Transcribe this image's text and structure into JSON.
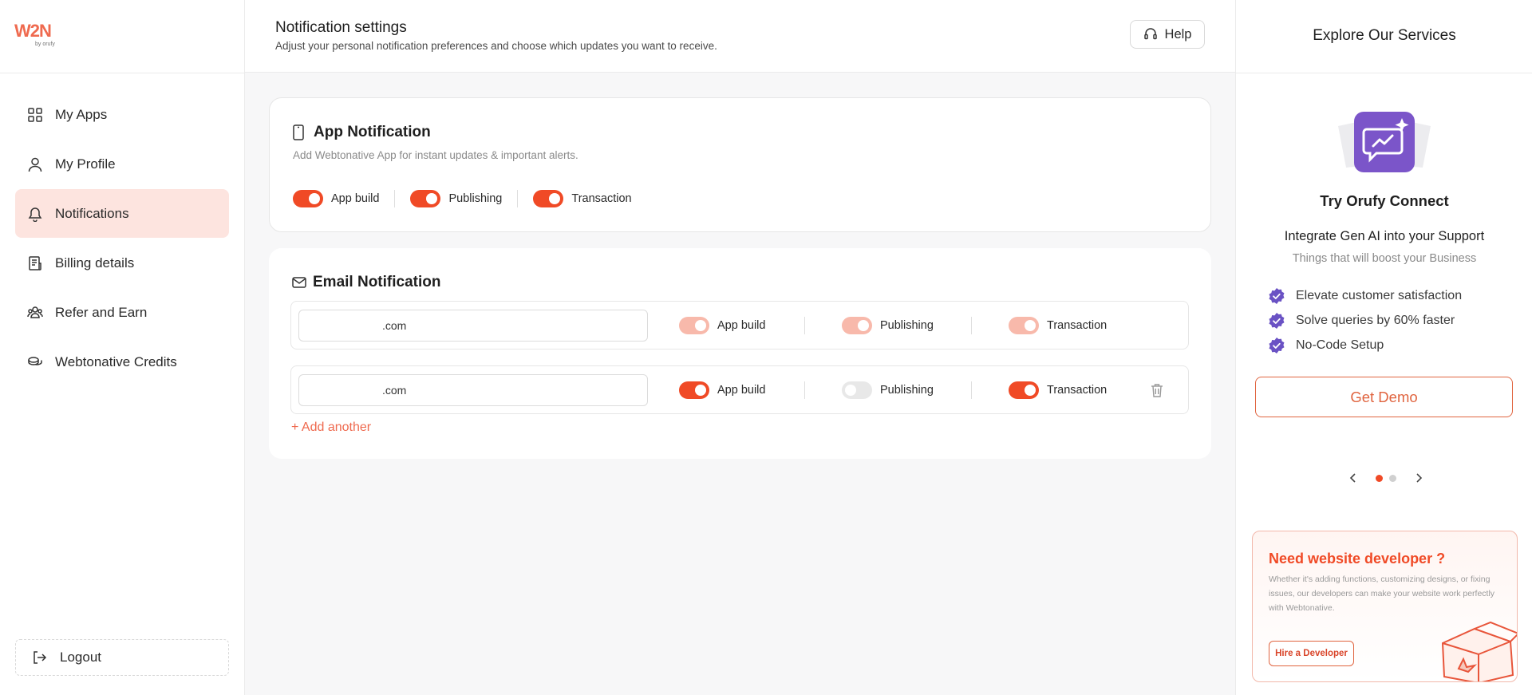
{
  "sidebar": {
    "logo": {
      "wordmark": "W2N",
      "tagline": "by orufy"
    },
    "items": [
      {
        "id": "my-apps",
        "label": "My Apps",
        "icon": "grid-icon",
        "active": false
      },
      {
        "id": "my-profile",
        "label": "My Profile",
        "icon": "user-icon",
        "active": false
      },
      {
        "id": "notifications",
        "label": "Notifications",
        "icon": "bell-icon",
        "active": true
      },
      {
        "id": "billing-details",
        "label": "Billing details",
        "icon": "receipt-icon",
        "active": false
      },
      {
        "id": "refer-and-earn",
        "label": "Refer and Earn",
        "icon": "users-icon",
        "active": false
      },
      {
        "id": "webtonative-credits",
        "label": "Webtonative Credits",
        "icon": "coins-icon",
        "active": false
      }
    ],
    "logout_label": "Logout"
  },
  "header": {
    "title": "Notification settings",
    "subtitle": "Adjust your personal notification preferences and choose which updates you want to receive.",
    "help_label": "Help"
  },
  "app_notification": {
    "title": "App Notification",
    "description": "Add Webtonative App for instant updates & important alerts.",
    "toggles": [
      {
        "label": "App build",
        "state": "on"
      },
      {
        "label": "Publishing",
        "state": "on"
      },
      {
        "label": "Transaction",
        "state": "on"
      }
    ]
  },
  "email_notification": {
    "title": "Email Notification",
    "rows": [
      {
        "email": ".com",
        "deletable": false,
        "toggles": [
          {
            "label": "App build",
            "state": "soft"
          },
          {
            "label": "Publishing",
            "state": "soft"
          },
          {
            "label": "Transaction",
            "state": "soft"
          }
        ]
      },
      {
        "email": ".com",
        "deletable": true,
        "toggles": [
          {
            "label": "App build",
            "state": "on"
          },
          {
            "label": "Publishing",
            "state": "off"
          },
          {
            "label": "Transaction",
            "state": "on"
          }
        ]
      }
    ],
    "add_label": "+ Add another"
  },
  "right_panel": {
    "title": "Explore Our Services",
    "promo": {
      "name": "Try Orufy Connect",
      "headline": "Integrate Gen AI into your Support",
      "subheadline": "Things that will boost your Business",
      "features": [
        "Elevate customer satisfaction",
        "Solve queries by 60% faster",
        "No-Code Setup"
      ],
      "cta_label": "Get Demo"
    },
    "carousel": {
      "count": 2,
      "active": 0
    },
    "developer": {
      "title": "Need website developer ?",
      "description": "Whether it's adding functions, customizing designs, or fixing issues, our developers can make your website work perfectly with Webtonative.",
      "cta_label": "Hire a Developer"
    }
  },
  "colors": {
    "accent": "#f04a26",
    "accent_soft": "#f8b9ab",
    "active_nav_bg": "#fde4df",
    "promo_purple": "#7b55c9"
  }
}
